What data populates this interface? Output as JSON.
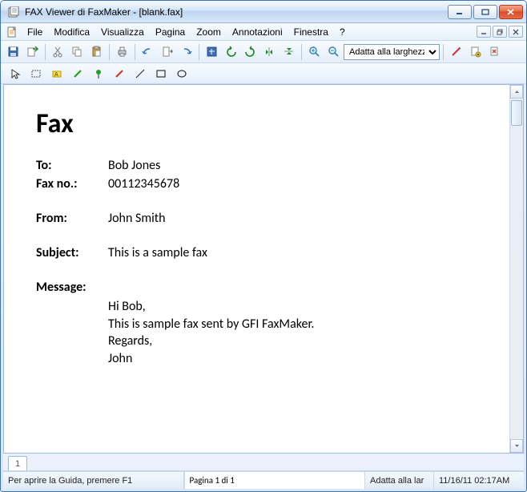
{
  "window": {
    "title": "FAX Viewer di FaxMaker - [blank.fax]"
  },
  "menu": {
    "items": [
      "File",
      "Modifica",
      "Visualizza",
      "Pagina",
      "Zoom",
      "Annotazioni",
      "Finestra",
      "?"
    ]
  },
  "toolbar": {
    "zoom_select": "Adatta alla larghezza"
  },
  "fax": {
    "heading": "Fax",
    "labels": {
      "to": "To:",
      "faxno": "Fax no.:",
      "from": "From:",
      "subject": "Subject:",
      "message": "Message:"
    },
    "to": "Bob Jones",
    "faxno": "00112345678",
    "from": "John Smith",
    "subject": "This is a sample fax",
    "message_lines": [
      "Hi Bob,",
      "This is sample fax sent by GFI FaxMaker.",
      "Regards,",
      "John"
    ]
  },
  "tabs": {
    "page1": "1"
  },
  "status": {
    "help": "Per aprire la Guida, premere F1",
    "page": "Pagina 1 di 1",
    "zoom": "Adatta alla lar",
    "datetime": "11/16/11 02:17AM"
  }
}
